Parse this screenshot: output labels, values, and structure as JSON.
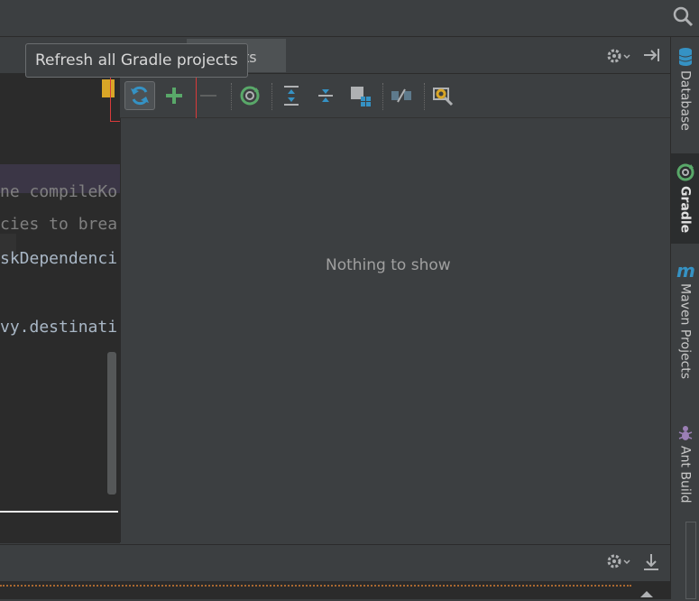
{
  "tooltip": {
    "text": "Refresh all Gradle projects"
  },
  "tool_window": {
    "title_partial": "ts",
    "empty_message": "Nothing to show",
    "toolbar": [
      {
        "name": "refresh-icon",
        "color": "#3592c4"
      },
      {
        "name": "plus-icon",
        "color": "#59a869"
      },
      {
        "name": "minus-icon",
        "color": "#6e6e6e"
      },
      {
        "name": "execute-task-icon",
        "color": "#59a869"
      },
      {
        "name": "expand-all-icon"
      },
      {
        "name": "collapse-all-icon"
      },
      {
        "name": "group-modules-icon",
        "color": "#3592c4"
      },
      {
        "name": "toggle-offline-icon"
      },
      {
        "name": "gradle-settings-icon",
        "color": "#d9a627"
      }
    ]
  },
  "editor": {
    "lines": [
      "ne compileKo",
      "cies to brea",
      "skDependenci",
      "vy.destinati"
    ]
  },
  "sidebar": {
    "tabs": [
      {
        "label": "Database",
        "icon": "database-icon"
      },
      {
        "label": "Gradle",
        "icon": "gradle-icon",
        "active": true
      },
      {
        "label": "Maven Projects",
        "icon": "maven-icon"
      },
      {
        "label": "Ant Build",
        "icon": "ant-icon"
      }
    ]
  },
  "colors": {
    "highlight": "#d83a3a",
    "accent_blue": "#3592c4",
    "accent_green": "#59a869"
  }
}
